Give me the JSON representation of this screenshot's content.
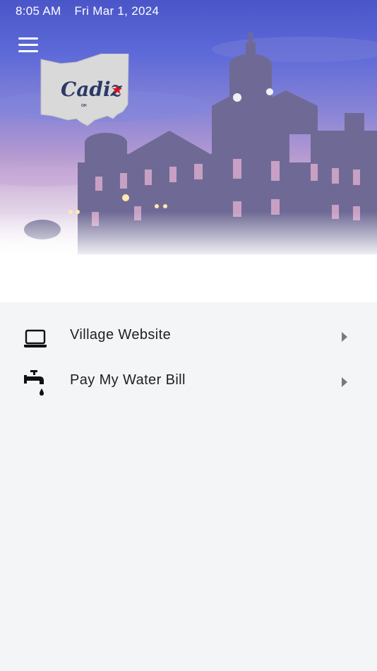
{
  "status_bar": {
    "time": "8:05 AM",
    "date": "Fri Mar 1, 2024"
  },
  "header": {
    "menu_icon": "hamburger-menu-icon",
    "logo_text": "Cadiz",
    "logo_state": "OH"
  },
  "menu": {
    "items": [
      {
        "label": "Village Website",
        "icon": "laptop-icon"
      },
      {
        "label": "Pay My Water Bill",
        "icon": "water-faucet-icon"
      }
    ]
  },
  "colors": {
    "logo_star": "#d7141b",
    "logo_text": "#2b3a67",
    "text": "#1f1f1f",
    "chevron": "#7a7a7a",
    "list_bg": "#f4f5f7"
  }
}
